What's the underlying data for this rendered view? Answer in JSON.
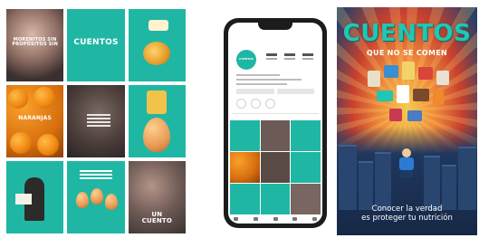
{
  "grid": {
    "tiles": [
      {
        "caption": "MORENITOS SIN PROPÓSITOS SIN"
      },
      {
        "caption": "CUENTOS"
      },
      {
        "caption": ""
      },
      {
        "caption": "NARANJAS"
      },
      {
        "caption": ""
      },
      {
        "caption": ""
      },
      {
        "caption": ""
      },
      {
        "caption": ""
      },
      {
        "caption": "UN CUENTO"
      }
    ]
  },
  "phone": {
    "avatar_text": "CUENTOS"
  },
  "poster": {
    "title": "CUENTOS",
    "subtitle": "QUE NO SE COMEN",
    "footer_line1": "Conocer la verdad",
    "footer_line2": "es proteger tu nutrición"
  },
  "colors": {
    "teal": "#1fb7a4",
    "poster_title": "#1fc7b4",
    "poster_sky": "#2a3f66"
  }
}
